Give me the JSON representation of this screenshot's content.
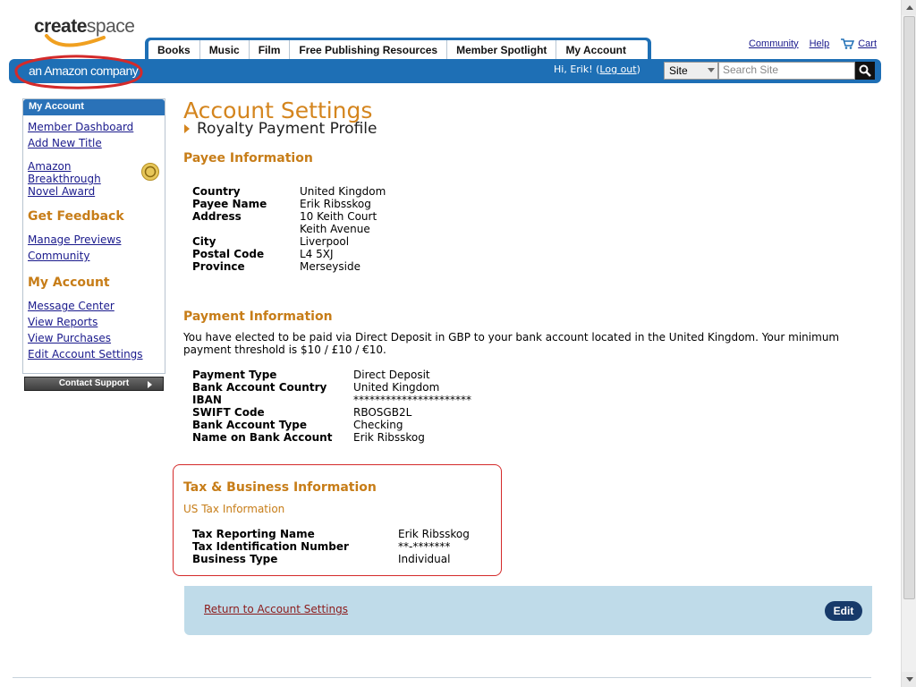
{
  "header": {
    "logo_create": "create",
    "logo_space": "space",
    "tagline": "an Amazon company",
    "tabs": [
      {
        "label": "Books"
      },
      {
        "label": "Music"
      },
      {
        "label": "Film"
      },
      {
        "label": "Free Publishing Resources"
      },
      {
        "label": "Member Spotlight"
      },
      {
        "label": "My Account"
      }
    ],
    "links": {
      "community": "Community",
      "help": "Help",
      "cart": "Cart"
    },
    "greeting": "Hi, Erik! (",
    "logout": "Log out",
    "greeting_end": ")",
    "site_select": "Site",
    "search_placeholder": "Search Site"
  },
  "sidebar": {
    "head": "My Account",
    "links_top": [
      "Member Dashboard",
      "Add New Title"
    ],
    "award_lines": [
      "Amazon",
      "Breakthrough",
      "Novel Award"
    ],
    "feedback_heading": "Get Feedback",
    "feedback_links": [
      "Manage Previews",
      "Community"
    ],
    "account_heading": "My Account",
    "account_links": [
      "Message Center",
      "View Reports",
      "View Purchases",
      "Edit Account Settings"
    ],
    "contact_button": "Contact Support"
  },
  "main": {
    "title": "Account Settings",
    "subtitle": "Royalty Payment Profile",
    "payee": {
      "heading": "Payee Information",
      "country_label": "Country",
      "country": "United Kingdom",
      "name_label": "Payee Name",
      "name": "Erik Ribsskog",
      "address_label": "Address",
      "address1": "10 Keith Court",
      "address2": "Keith Avenue",
      "city_label": "City",
      "city": "Liverpool",
      "postal_label": "Postal Code",
      "postal": "L4 5XJ",
      "province_label": "Province",
      "province": "Merseyside"
    },
    "payment": {
      "heading": "Payment Information",
      "description": "You have elected to be paid via Direct Deposit in GBP to your bank account located in the United Kingdom. Your minimum payment threshold is $10 / £10 / €10.",
      "type_label": "Payment Type",
      "type": "Direct Deposit",
      "country_label": "Bank Account Country",
      "country": "United Kingdom",
      "iban_label": "IBAN",
      "iban": "**********************",
      "swift_label": "SWIFT Code",
      "swift": "RBOSGB2L",
      "acct_type_label": "Bank Account Type",
      "acct_type": "Checking",
      "acct_name_label": "Name on Bank Account",
      "acct_name": "Erik Ribsskog"
    },
    "tax": {
      "heading": "Tax & Business Information",
      "subheading": "US Tax Information",
      "reporting_label": "Tax Reporting Name",
      "reporting": "Erik Ribsskog",
      "tin_label": "Tax Identification Number",
      "tin": "**-*******",
      "business_label": "Business Type",
      "business": "Individual"
    },
    "footer": {
      "return_link": "Return to Account Settings",
      "edit_button": "Edit"
    }
  },
  "colors": {
    "brand_blue": "#1e6fb5",
    "heading_orange": "#c77d18",
    "annotation_red": "#d42a2a",
    "footer_panel": "#bfdbe9"
  }
}
